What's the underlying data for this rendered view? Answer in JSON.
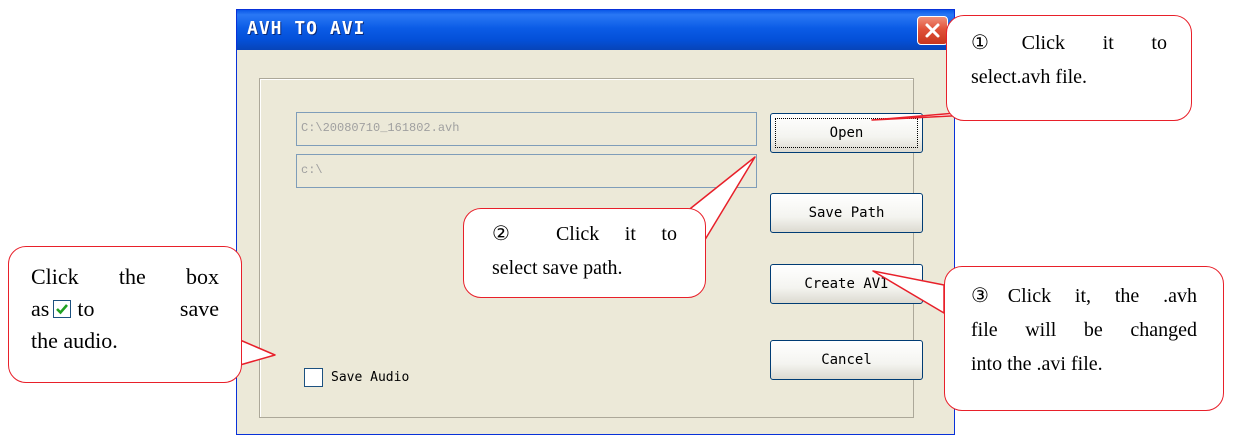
{
  "window": {
    "title": "AVH TO AVI"
  },
  "fields": {
    "source_path": "C:\\20080710_161802.avh",
    "save_path": "c:\\"
  },
  "buttons": {
    "open": "Open",
    "save_path": "Save Path",
    "create_avi": "Create AVI",
    "cancel": "Cancel"
  },
  "checkbox": {
    "label": "Save Audio",
    "checked": false
  },
  "callouts": {
    "open_line1": "①Click it to",
    "open_line2": "select.avh file.",
    "save_line1": "② Click it to",
    "save_line2": "select save path.",
    "create_line1": "③Click it, the .avh",
    "create_line2": "file will be changed",
    "create_line3": "into the .avi file.",
    "audio_line1": "Click the box",
    "audio_line2_a": "as",
    "audio_line2_b": "to save",
    "audio_line3": "the audio."
  },
  "colors": {
    "titlebar": "#0b5ce6",
    "callout_border": "#e8202a",
    "dialog_face": "#ece9d8"
  }
}
